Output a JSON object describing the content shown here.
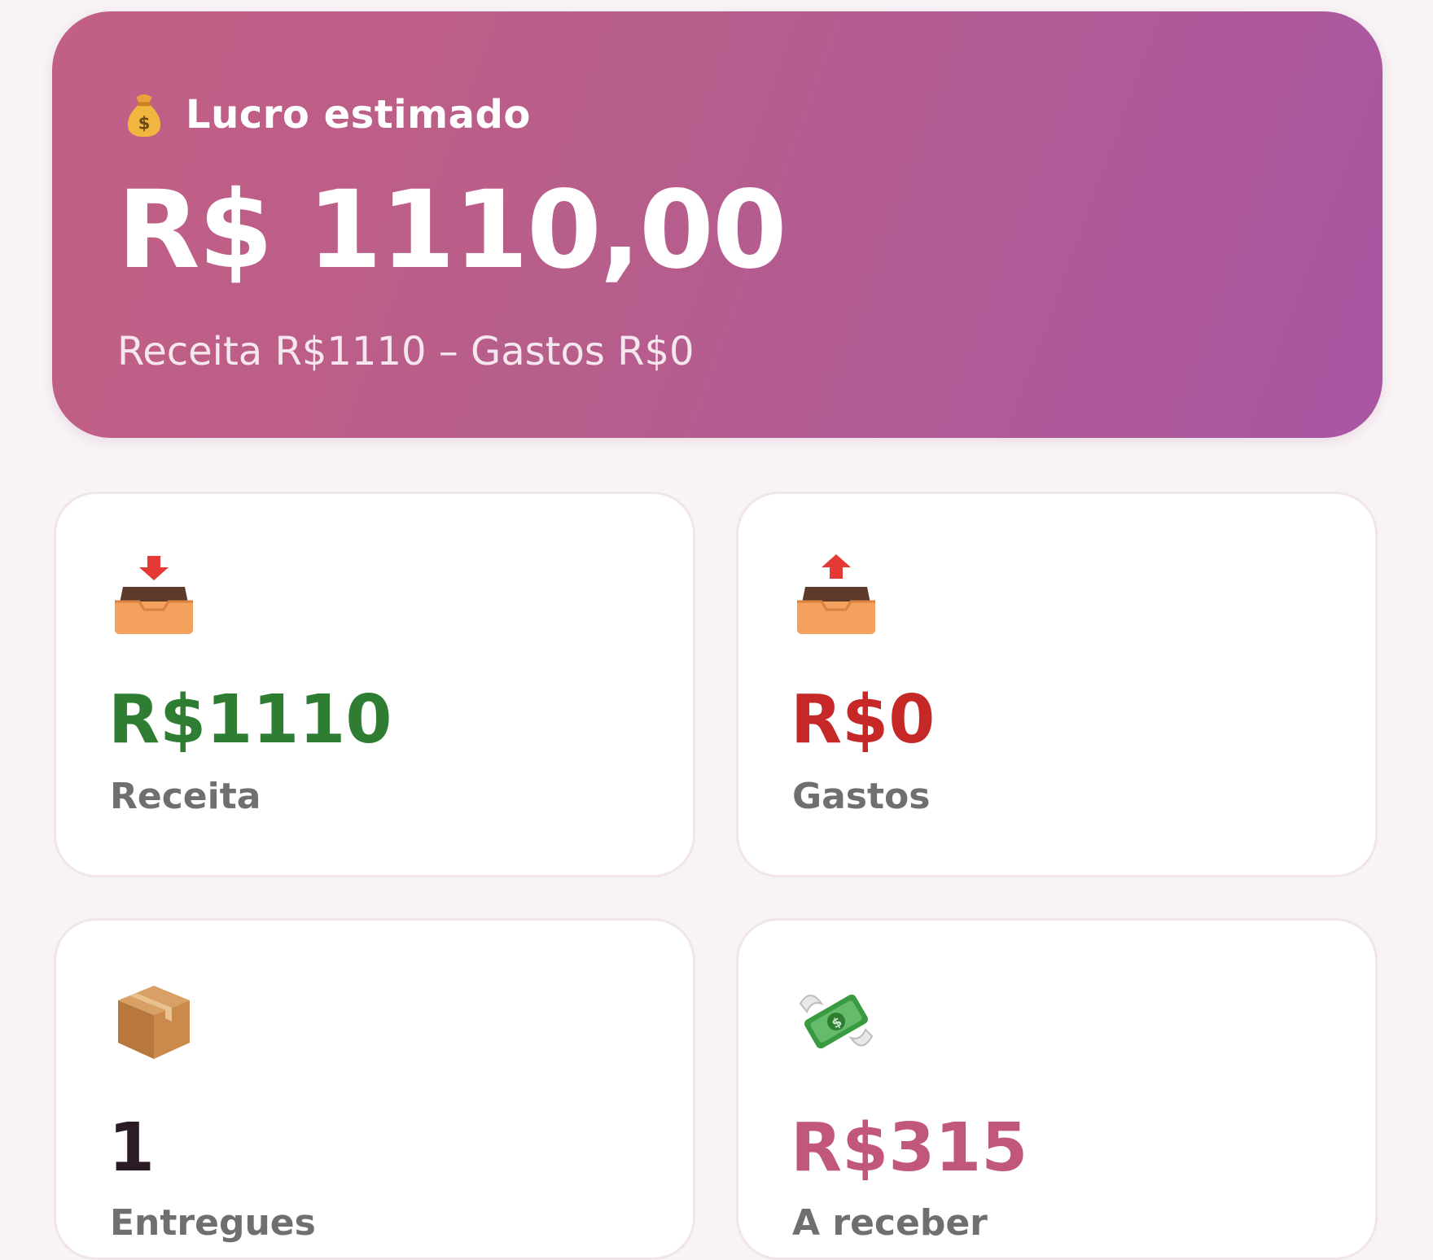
{
  "profit": {
    "icon": "moneybag-icon",
    "label": "Lucro estimado",
    "value": "R$ 1110,00",
    "breakdown": "Receita R$1110 – Gastos R$0"
  },
  "stats": {
    "receita": {
      "icon": "inbox-tray-icon",
      "value": "R$1110",
      "label": "Receita",
      "color": "#2e7d32"
    },
    "gastos": {
      "icon": "outbox-tray-icon",
      "value": "R$0",
      "label": "Gastos",
      "color": "#c62828"
    },
    "entregues": {
      "icon": "package-icon",
      "value": "1",
      "label": "Entregues",
      "color": "#2b1b24"
    },
    "a_receber": {
      "icon": "money-with-wings-icon",
      "value": "R$315",
      "label": "A receber",
      "color": "#c2577e"
    }
  },
  "colors": {
    "card_gradient_start": "#c35f85",
    "card_gradient_end": "#a956a3",
    "page_background": "#f8f4f6"
  }
}
